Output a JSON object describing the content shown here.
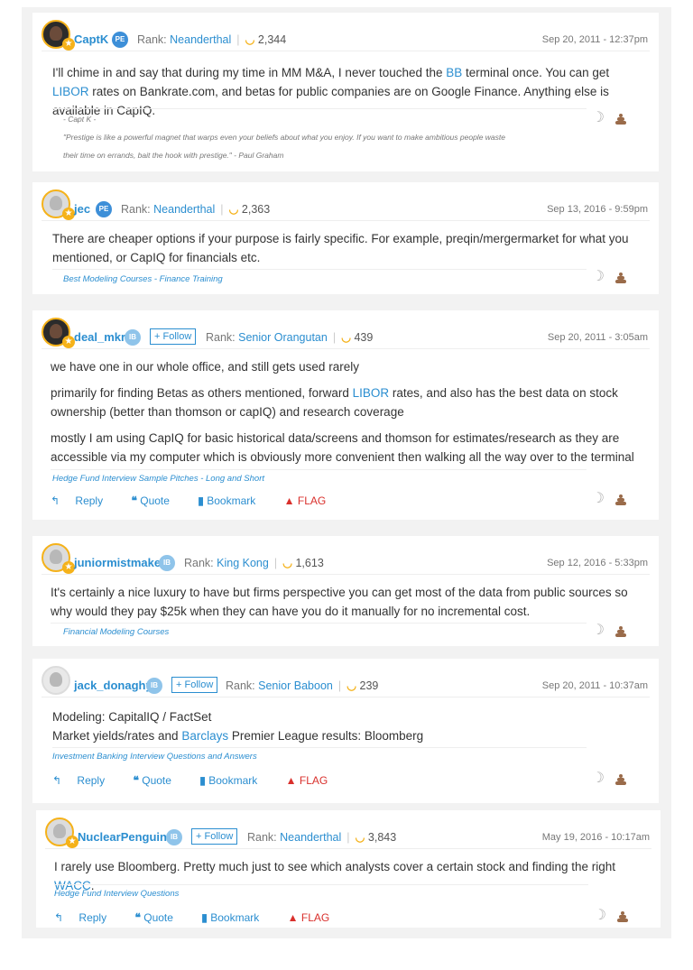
{
  "posts": [
    {
      "username": "CaptK",
      "badge": "PE",
      "rank_label": "Rank:",
      "rank": "Neanderthal",
      "bananas": "2,344",
      "date": "Sep 20, 2011 - 12:37pm",
      "body_parts": [
        "I'll chime in and say that during my time in MM M&A, I never touched the ",
        "BB",
        " terminal once. You can get ",
        "LIBOR",
        " rates on Bankrate.com, and betas for public companies are on Google Finance. Anything else is available in CapIQ."
      ],
      "signature": [
        "- Capt K -",
        "\"Prestige is like a powerful magnet that warps even your beliefs about what you enjoy. If you want to make ambitious people waste",
        "their time on errands, bait the hook with prestige.\" - Paul Graham"
      ]
    },
    {
      "username": "jec",
      "badge": "PE",
      "rank_label": "Rank:",
      "rank": "Neanderthal",
      "bananas": "2,363",
      "date": "Sep 13, 2016 - 9:59pm",
      "body": "There are cheaper options if your purpose is fairly specific. For example, preqin/mergermarket for what you mentioned, or CapIQ for financials etc.",
      "footlink": "Best Modeling Courses - Finance Training"
    },
    {
      "username": "deal_mkr",
      "badge": "IB",
      "follow": "+ Follow",
      "rank_label": "Rank:",
      "rank": "Senior Orangutan",
      "bananas": "439",
      "date": "Sep 20, 2011 - 3:05am",
      "body1": "we have one in our whole office, and still gets used rarely",
      "body2_parts": [
        "primarily for finding Betas as others mentioned, forward ",
        "LIBOR",
        " rates, and also has the best data on stock ownership (better than thomson or capIQ) and research coverage"
      ],
      "body3": "mostly I am using CapIQ for basic historical data/screens and thomson for estimates/research as they are accessible via my computer which is obviously more convenient then walking all the way over to the terminal",
      "footlink": "Hedge Fund Interview Sample Pitches - Long and Short"
    },
    {
      "username": "juniormistmaker",
      "badge": "IB",
      "rank_label": "Rank:",
      "rank": "King Kong",
      "bananas": "1,613",
      "date": "Sep 12, 2016 - 5:33pm",
      "body": "It's certainly a nice luxury to have but firms perspective you can get most of the data from public sources so why would they pay $25k when they can have you do it manually for no incremental cost.",
      "footlink": "Financial Modeling Courses"
    },
    {
      "username": "jack_donaghy",
      "badge": "IB",
      "follow": "+ Follow",
      "rank_label": "Rank:",
      "rank": "Senior Baboon",
      "bananas": "239",
      "date": "Sep 20, 2011 - 10:37am",
      "line1": "Modeling: CapitalIQ / FactSet",
      "line2_parts": [
        "Market yields/rates and ",
        "Barclays",
        " Premier League results: Bloomberg"
      ],
      "footlink": "Investment Banking Interview Questions and Answers"
    },
    {
      "username": "NuclearPenguins",
      "badge": "IB",
      "follow": "+ Follow",
      "rank_label": "Rank:",
      "rank": "Neanderthal",
      "bananas": "3,843",
      "date": "May 19, 2016 - 10:17am",
      "body_parts": [
        "I rarely use Bloomberg. Pretty much just to see which analysts cover a certain stock and finding the right ",
        "WACC",
        "."
      ],
      "footlink": "Hedge Fund Interview Questions"
    }
  ],
  "actions": {
    "reply": "Reply",
    "quote": "Quote",
    "bookmark": "Bookmark",
    "flag": "FLAG"
  },
  "icons": {
    "reply": "reply-arrow-icon",
    "quote": "quote-icon",
    "bookmark": "bookmark-icon",
    "flag": "warning-icon",
    "banana": "banana-icon",
    "moon": "banana-vote-icon",
    "poop": "poop-vote-icon"
  },
  "colors": {
    "link": "#2b8ed0",
    "flag": "#d9302c",
    "banana": "#f5b21a"
  }
}
